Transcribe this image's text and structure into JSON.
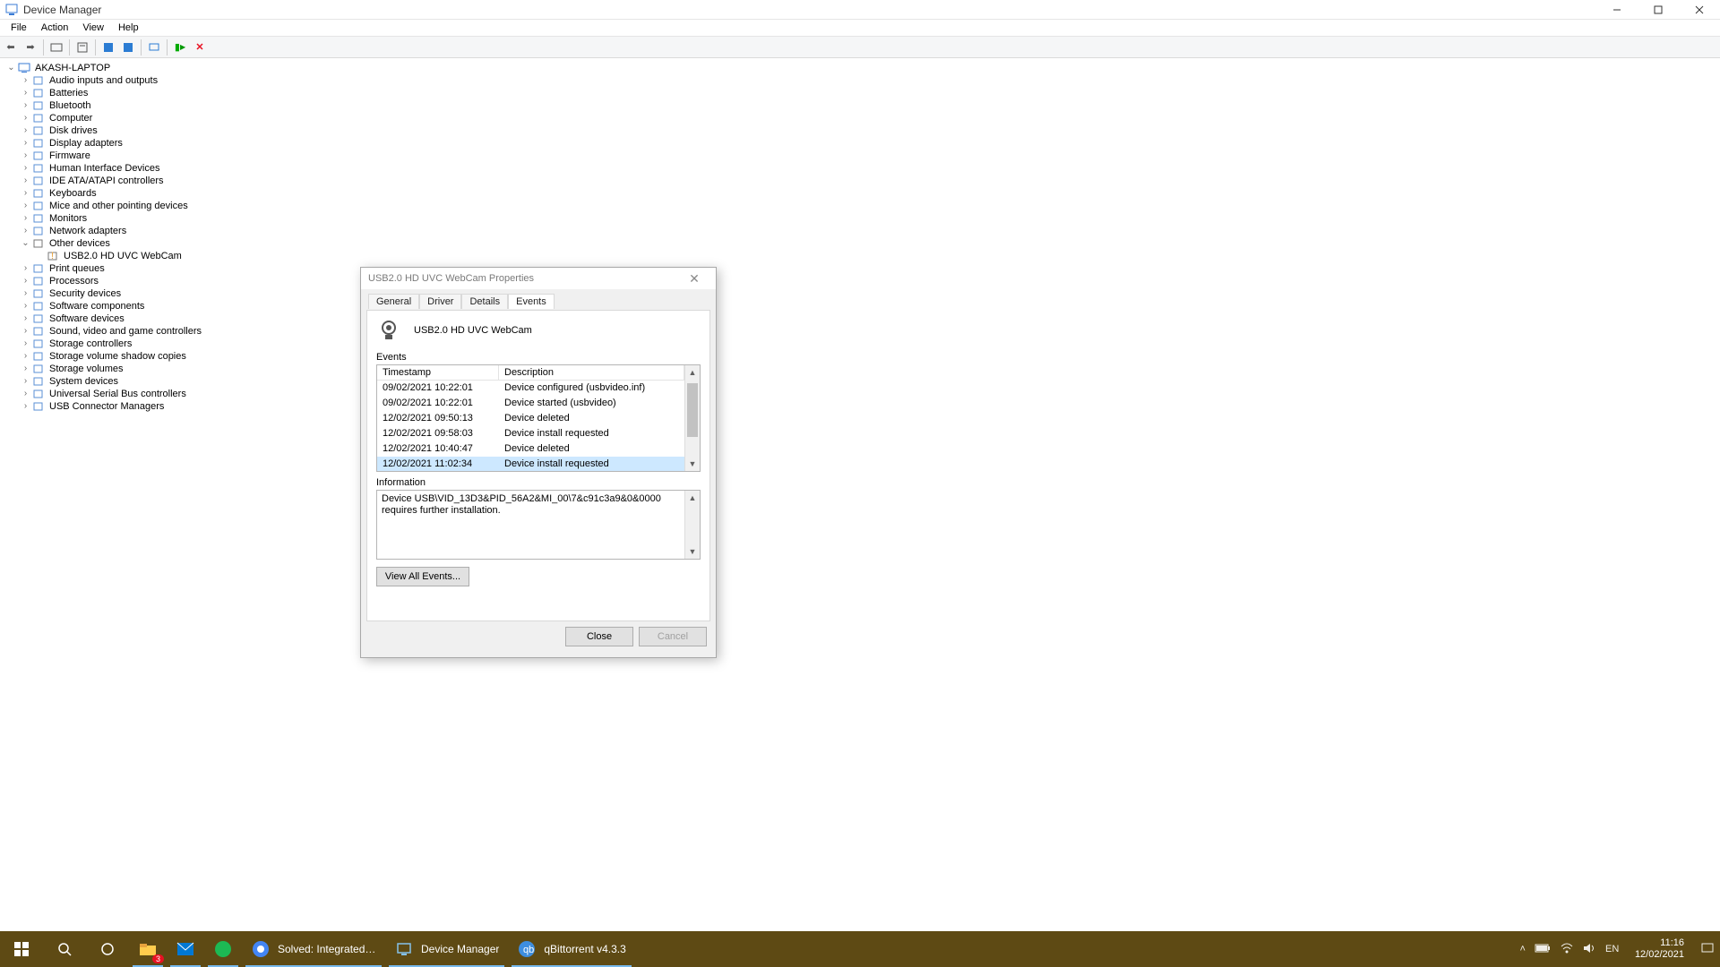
{
  "window": {
    "title": "Device Manager"
  },
  "menu": {
    "file": "File",
    "action": "Action",
    "view": "View",
    "help": "Help"
  },
  "root": "AKASH-LAPTOP",
  "categories": [
    "Audio inputs and outputs",
    "Batteries",
    "Bluetooth",
    "Computer",
    "Disk drives",
    "Display adapters",
    "Firmware",
    "Human Interface Devices",
    "IDE ATA/ATAPI controllers",
    "Keyboards",
    "Mice and other pointing devices",
    "Monitors",
    "Network adapters"
  ],
  "otherDevices": {
    "label": "Other devices",
    "child": "USB2.0 HD UVC WebCam"
  },
  "categories2": [
    "Print queues",
    "Processors",
    "Security devices",
    "Software components",
    "Software devices",
    "Sound, video and game controllers",
    "Storage controllers",
    "Storage volume shadow copies",
    "Storage volumes",
    "System devices",
    "Universal Serial Bus controllers",
    "USB Connector Managers"
  ],
  "dialog": {
    "title": "USB2.0 HD UVC WebCam Properties",
    "tabs": {
      "general": "General",
      "driver": "Driver",
      "details": "Details",
      "events": "Events"
    },
    "deviceName": "USB2.0 HD UVC WebCam",
    "eventsLabel": "Events",
    "headers": {
      "ts": "Timestamp",
      "desc": "Description"
    },
    "rows": [
      {
        "ts": "09/02/2021 10:22:01",
        "desc": "Device configured (usbvideo.inf)"
      },
      {
        "ts": "09/02/2021 10:22:01",
        "desc": "Device started (usbvideo)"
      },
      {
        "ts": "12/02/2021 09:50:13",
        "desc": "Device deleted"
      },
      {
        "ts": "12/02/2021 09:58:03",
        "desc": "Device install requested"
      },
      {
        "ts": "12/02/2021 10:40:47",
        "desc": "Device deleted"
      },
      {
        "ts": "12/02/2021 11:02:34",
        "desc": "Device install requested"
      }
    ],
    "selectedRow": 5,
    "infoLabel": "Information",
    "infoText": "Device USB\\VID_13D3&PID_56A2&MI_00\\7&c91c3a9&0&0000 requires further installation.",
    "viewAll": "View All Events...",
    "close": "Close",
    "cancel": "Cancel"
  },
  "taskbar": {
    "tasks": [
      {
        "icon": "explorer",
        "label": "",
        "badge": "3"
      },
      {
        "icon": "mail",
        "label": ""
      },
      {
        "icon": "spotify",
        "label": ""
      },
      {
        "icon": "chrome",
        "label": "Solved: Integrated ..."
      },
      {
        "icon": "devmgr",
        "label": "Device Manager"
      },
      {
        "icon": "qbit",
        "label": "qBittorrent v4.3.3"
      }
    ],
    "time": "11:16",
    "date": "12/02/2021"
  }
}
